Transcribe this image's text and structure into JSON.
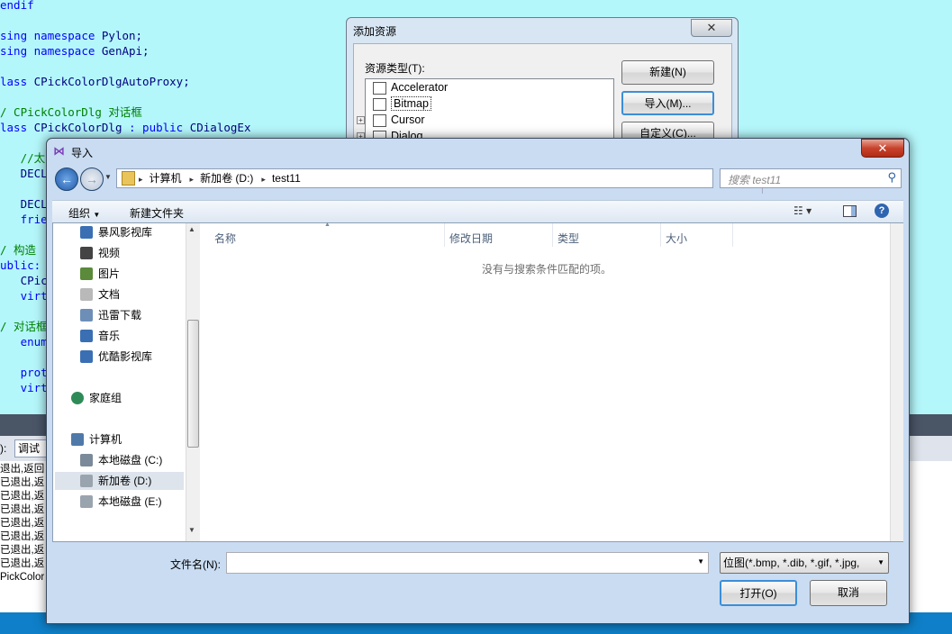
{
  "editor": {
    "lines": [
      {
        "parts": [
          {
            "t": "endif",
            "c": "kw"
          }
        ]
      },
      {
        "parts": []
      },
      {
        "parts": [
          {
            "t": "sing ",
            "c": "kw"
          },
          {
            "t": "namespace ",
            "c": "kw"
          },
          {
            "t": "Pylon;",
            "c": "pl"
          }
        ]
      },
      {
        "parts": [
          {
            "t": "sing ",
            "c": "kw"
          },
          {
            "t": "namespace ",
            "c": "kw"
          },
          {
            "t": "GenApi;",
            "c": "pl"
          }
        ]
      },
      {
        "parts": []
      },
      {
        "parts": [
          {
            "t": "lass ",
            "c": "kw"
          },
          {
            "t": "CPickColorDlgAutoProxy;",
            "c": "pl"
          }
        ]
      },
      {
        "parts": []
      },
      {
        "parts": [
          {
            "t": "/ CPickColorDlg 对话框",
            "c": "cm"
          }
        ]
      },
      {
        "parts": [
          {
            "t": "lass ",
            "c": "kw"
          },
          {
            "t": "CPickColorDlg ",
            "c": "pl"
          },
          {
            "t": ": public ",
            "c": "kw"
          },
          {
            "t": "CDialogEx",
            "c": "pl"
          }
        ]
      },
      {
        "parts": []
      },
      {
        "parts": [
          {
            "t": "   //太",
            "c": "cm"
          }
        ]
      },
      {
        "parts": [
          {
            "t": "   DECL",
            "c": "pl"
          }
        ]
      },
      {
        "parts": []
      },
      {
        "parts": [
          {
            "t": "   DECL",
            "c": "pl"
          }
        ]
      },
      {
        "parts": [
          {
            "t": "   frie",
            "c": "kw"
          }
        ]
      },
      {
        "parts": []
      },
      {
        "parts": [
          {
            "t": "/ 构造",
            "c": "cm"
          }
        ]
      },
      {
        "parts": [
          {
            "t": "ublic:",
            "c": "kw"
          }
        ]
      },
      {
        "parts": [
          {
            "t": "   CPic",
            "c": "pl"
          }
        ]
      },
      {
        "parts": [
          {
            "t": "   virt",
            "c": "kw"
          }
        ]
      },
      {
        "parts": []
      },
      {
        "parts": [
          {
            "t": "/ 对话框",
            "c": "cm"
          }
        ]
      },
      {
        "parts": [
          {
            "t": "   enum",
            "c": "kw"
          }
        ]
      },
      {
        "parts": []
      },
      {
        "parts": [
          {
            "t": "   prot",
            "c": "kw"
          }
        ]
      },
      {
        "parts": [
          {
            "t": "   virt",
            "c": "kw"
          }
        ]
      }
    ]
  },
  "output": {
    "label": "):",
    "combo": "调试",
    "lines": [
      "退出,返回",
      "已退出,返",
      "已退出,返",
      "已退出,返",
      "已退出,返",
      "已退出,返",
      "已退出,返",
      "已退出,返",
      "PickColor"
    ]
  },
  "add_resource": {
    "title": "添加资源",
    "close": "✕",
    "type_label": "资源类型(T):",
    "tree": [
      {
        "label": "Accelerator",
        "expand": false
      },
      {
        "label": "Bitmap",
        "expand": false,
        "selected": true
      },
      {
        "label": "Cursor",
        "expand": true
      },
      {
        "label": "Dialog",
        "expand": true
      }
    ],
    "buttons": {
      "new": "新建(N)",
      "import": "导入(M)...",
      "custom": "自定义(C)..."
    }
  },
  "import_dialog": {
    "title": "导入",
    "close": "✕",
    "breadcrumb": [
      "计算机",
      "新加卷 (D:)",
      "test11"
    ],
    "search_placeholder": "搜索 test11",
    "toolbar": {
      "organize": "组织",
      "new_folder": "新建文件夹"
    },
    "nav": [
      {
        "label": "暴风影视库",
        "icon": "media-library-icon",
        "indent": 1
      },
      {
        "label": "视频",
        "icon": "video-icon",
        "indent": 1
      },
      {
        "label": "图片",
        "icon": "pictures-icon",
        "indent": 1
      },
      {
        "label": "文档",
        "icon": "document-icon",
        "indent": 1
      },
      {
        "label": "迅雷下载",
        "icon": "download-folder-icon",
        "indent": 1
      },
      {
        "label": "音乐",
        "icon": "music-icon",
        "indent": 1
      },
      {
        "label": "优酷影视库",
        "icon": "media-library-icon",
        "indent": 1
      },
      {
        "label": "",
        "icon": "",
        "indent": 0
      },
      {
        "label": "家庭组",
        "icon": "homegroup-icon",
        "indent": 0
      },
      {
        "label": "",
        "icon": "",
        "indent": 0
      },
      {
        "label": "计算机",
        "icon": "computer-icon",
        "indent": 0
      },
      {
        "label": "本地磁盘 (C:)",
        "icon": "system-drive-icon",
        "indent": 1
      },
      {
        "label": "新加卷 (D:)",
        "icon": "drive-icon",
        "indent": 1,
        "selected": true
      },
      {
        "label": "本地磁盘 (E:)",
        "icon": "drive-icon",
        "indent": 1
      }
    ],
    "columns": [
      "名称",
      "修改日期",
      "类型",
      "大小"
    ],
    "empty_message": "没有与搜索条件匹配的项。",
    "filename_label": "文件名(N):",
    "filename_value": "",
    "filter_value": "位图(*.bmp, *.dib, *.gif, *.jpg,",
    "open_button": "打开(O)",
    "cancel_button": "取消"
  }
}
